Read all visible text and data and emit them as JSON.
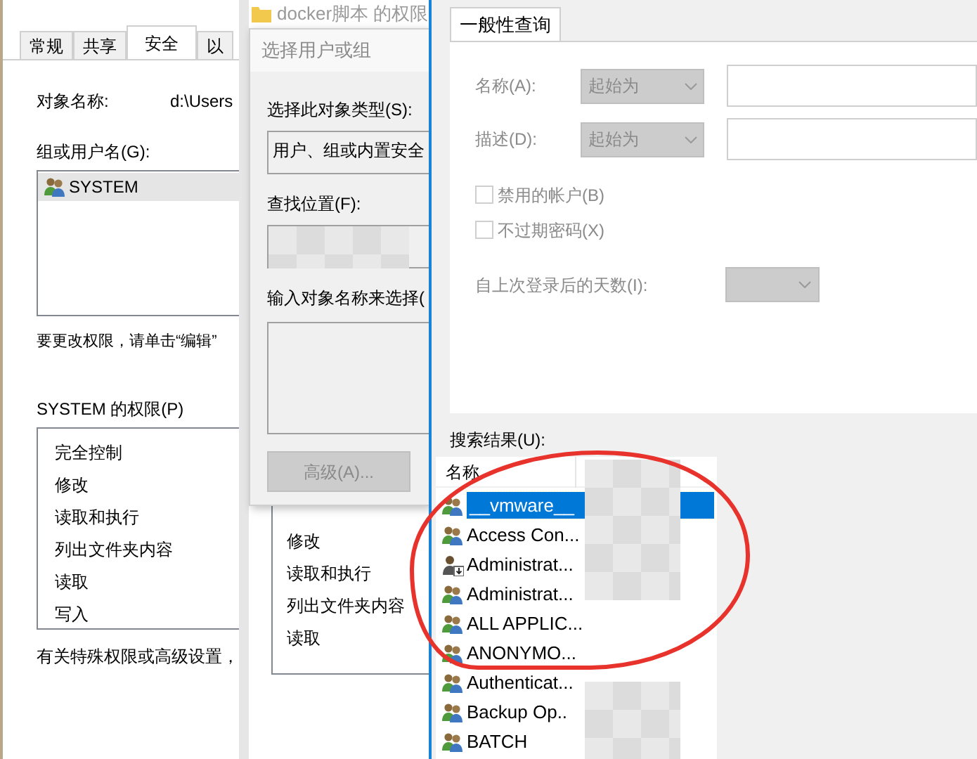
{
  "properties_window": {
    "tabs": [
      {
        "label": "常规",
        "selected": false
      },
      {
        "label": "共享",
        "selected": false
      },
      {
        "label": "安全",
        "selected": true
      },
      {
        "label": "以",
        "selected": false
      }
    ],
    "object_name_label": "对象名称:",
    "object_name_value": "d:\\Users",
    "groups_label": "组或用户名(G):",
    "groups": [
      {
        "name": "SYSTEM",
        "selected": true
      }
    ],
    "edit_hint": "要更改权限，请单击“编辑”",
    "permissions_label": "SYSTEM 的权限(P)",
    "permissions": [
      "完全控制",
      "修改",
      "读取和执行",
      "列出文件夹内容",
      "读取",
      "写入"
    ],
    "advanced_hint": "有关特殊权限或高级设置，"
  },
  "permissions_window": {
    "title": "docker脚本 的权限",
    "permissions": [
      "修改",
      "读取和执行",
      "列出文件夹内容",
      "读取"
    ]
  },
  "select_dialog": {
    "title": "选择用户或组",
    "object_type_label": "选择此对象类型(S):",
    "object_type_value": "用户、组或内置安全",
    "location_label": "查找位置(F):",
    "enter_names_label": "输入对象名称来选择(",
    "advanced_button": {
      "label": "高级(A)...",
      "disabled": true
    }
  },
  "find_dialog": {
    "tabs": [
      {
        "label": "一般性查询",
        "selected": true
      }
    ],
    "disabled": true,
    "fields": [
      {
        "label": "名称(A):",
        "mode": "起始为"
      },
      {
        "label": "描述(D):",
        "mode": "起始为"
      }
    ],
    "checkboxes": [
      {
        "label": "禁用的帐户(B)",
        "checked": false
      },
      {
        "label": "不过期密码(X)",
        "checked": false
      }
    ],
    "days_label": "自上次登录后的天数(I):",
    "results_label": "搜索结果(U):",
    "results_columns": [
      "名称"
    ],
    "results": [
      {
        "name": "__vmware__",
        "kind": "group",
        "selected": true
      },
      {
        "name": "Access Con...",
        "kind": "group",
        "selected": false
      },
      {
        "name": "Administrat...",
        "kind": "user",
        "selected": false
      },
      {
        "name": "Administrat...",
        "kind": "group",
        "selected": false
      },
      {
        "name": "ALL APPLIC...",
        "kind": "group",
        "selected": false
      },
      {
        "name": "ANONYMO...",
        "kind": "group",
        "selected": false
      },
      {
        "name": "Authenticat...",
        "kind": "group",
        "selected": false
      },
      {
        "name": "Backup Op..",
        "kind": "group",
        "selected": false
      },
      {
        "name": "BATCH",
        "kind": "group",
        "selected": false
      }
    ]
  },
  "highlight_ellipse": true
}
